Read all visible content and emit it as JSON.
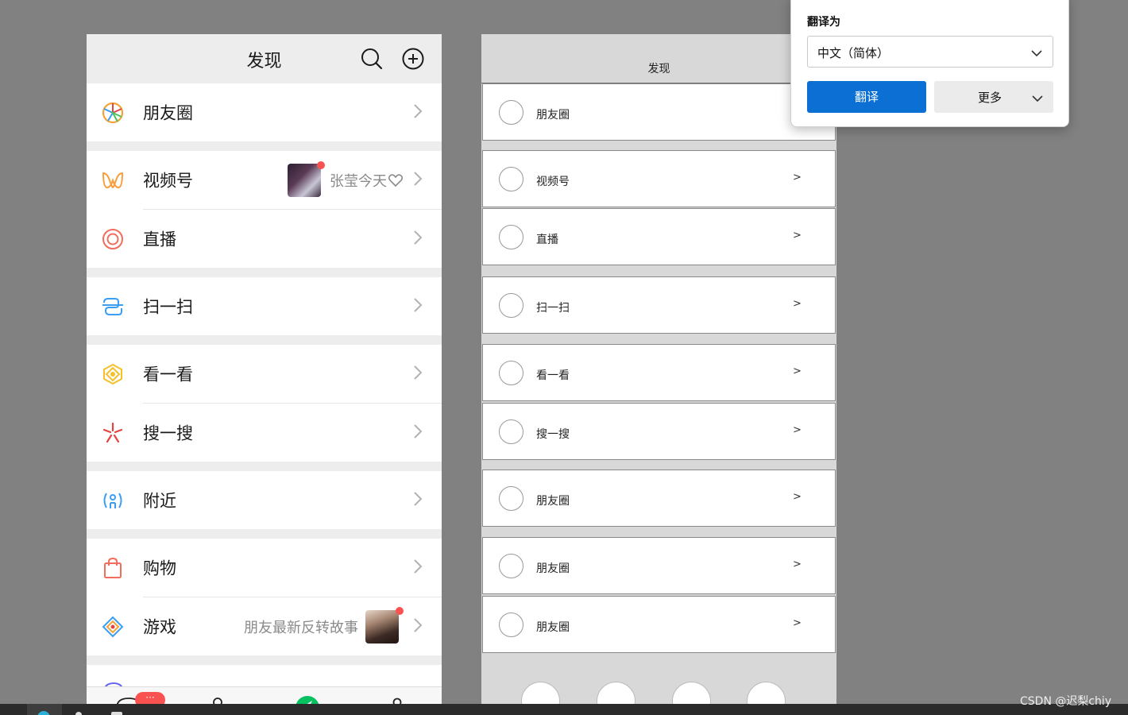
{
  "discover_app": {
    "title": "发现",
    "rows": {
      "moments": "朋友圈",
      "channels": "视频号",
      "channels_meta": "张莹今天",
      "live": "直播",
      "scan": "扫一扫",
      "top_stories": "看一看",
      "search": "搜一搜",
      "nearby": "附近",
      "shopping": "购物",
      "games": "游戏",
      "games_meta": "朋友最新反转故事"
    },
    "tabbar_badge": "···",
    "colors": {
      "accent_green": "#07c160",
      "badge_red": "#fa5151",
      "background": "#ededed"
    }
  },
  "wireframe": {
    "title": "发现",
    "arrow": ">",
    "rows": [
      "朋友圈",
      "视频号",
      "直播",
      "扫一扫",
      "看一看",
      "搜一搜",
      "朋友圈",
      "朋友圈",
      "朋友圈"
    ]
  },
  "translate_popup": {
    "heading": "翻译为",
    "language": "中文（简体）",
    "translate_button": "翻译",
    "more_button": "更多",
    "accent": "#0b6fd3"
  },
  "watermark": "CSDN @迟梨chiy"
}
